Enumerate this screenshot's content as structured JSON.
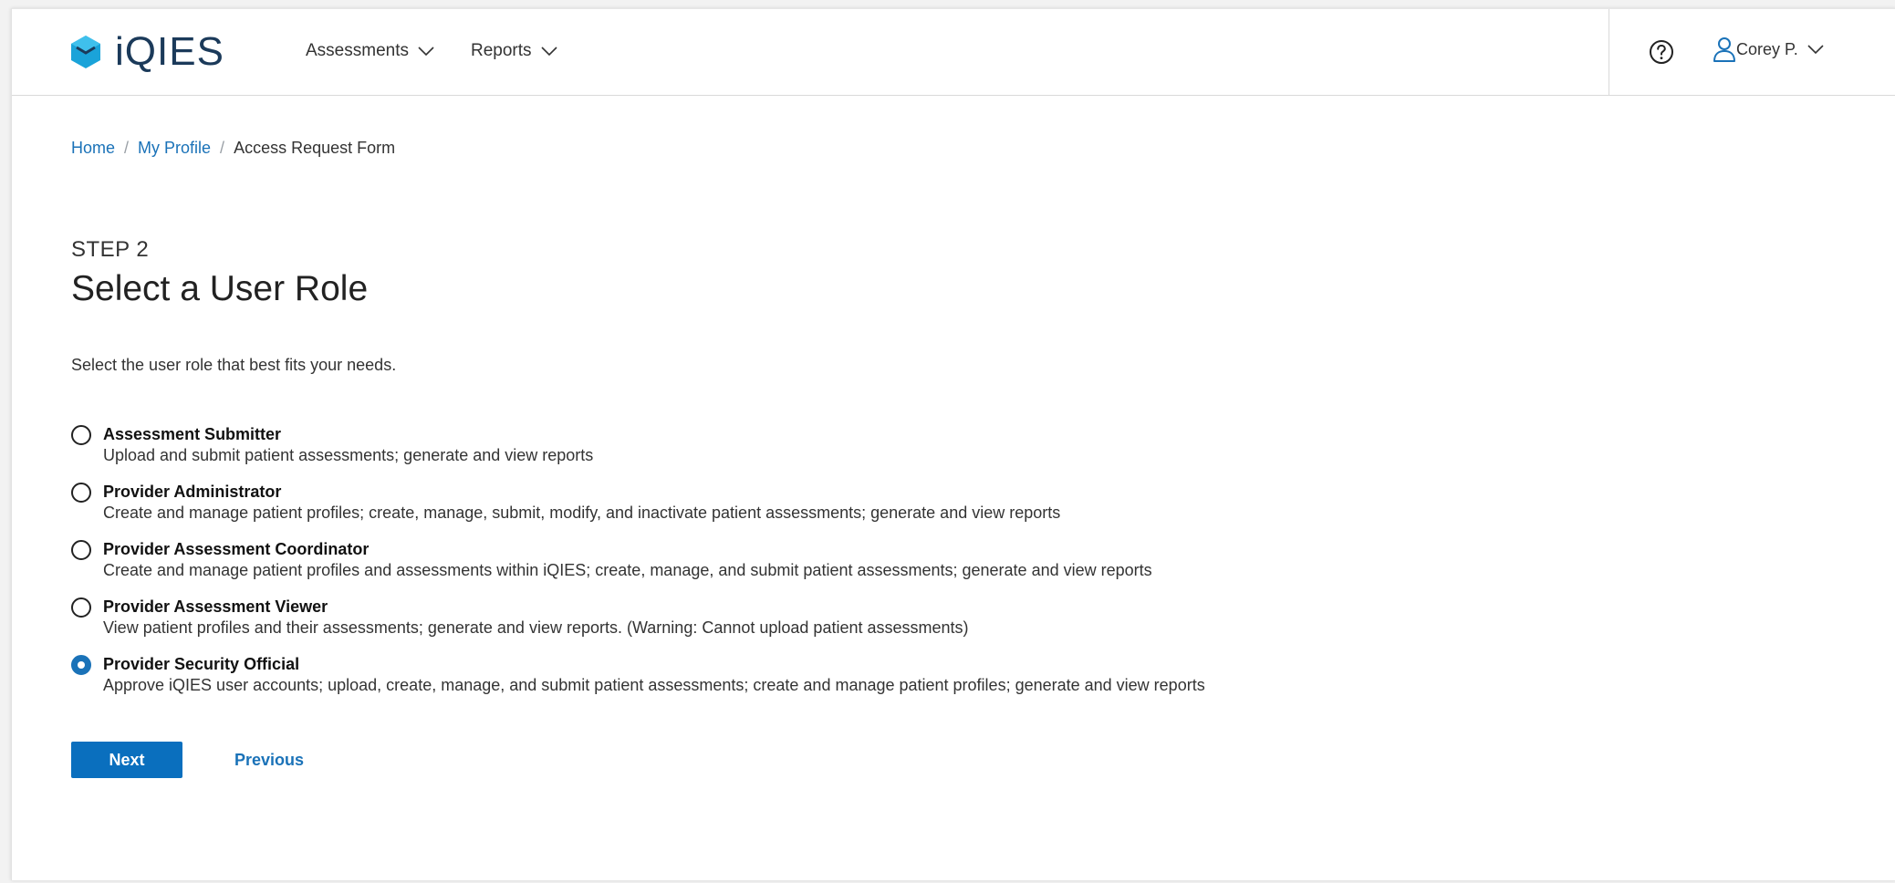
{
  "header": {
    "logo_text": "iQIES",
    "nav": [
      {
        "label": "Assessments"
      },
      {
        "label": "Reports"
      }
    ],
    "user_name": "Corey P."
  },
  "breadcrumb": {
    "home": "Home",
    "profile": "My Profile",
    "current": "Access Request Form"
  },
  "main": {
    "step_label": "STEP 2",
    "title": "Select a User Role",
    "instruction": "Select the user role that best fits your needs.",
    "roles": [
      {
        "title": "Assessment Submitter",
        "description": "Upload and submit patient assessments; generate and view reports",
        "selected": false
      },
      {
        "title": "Provider Administrator",
        "description": "Create and manage patient profiles; create, manage, submit, modify, and inactivate patient assessments; generate and view reports",
        "selected": false
      },
      {
        "title": "Provider Assessment Coordinator",
        "description": "Create and manage patient profiles and assessments within iQIES; create, manage, and submit patient assessments; generate and view reports",
        "selected": false
      },
      {
        "title": "Provider Assessment Viewer",
        "description": "View patient profiles and their assessments; generate and view reports. (Warning: Cannot upload patient assessments)",
        "selected": false
      },
      {
        "title": "Provider Security Official",
        "description": "Approve iQIES user accounts; upload, create, manage, and submit patient assessments; create and manage patient profiles; generate and view reports",
        "selected": true
      }
    ],
    "next_label": "Next",
    "previous_label": "Previous"
  },
  "colors": {
    "accent": "#1a72b8",
    "primary_button": "#0a6fbe",
    "logo_icon": "#1aa3d9"
  },
  "icons": {
    "logo": "cube-logo-icon",
    "help": "question-circle-icon",
    "user": "user-icon",
    "dropdown": "chevron-down-icon"
  }
}
